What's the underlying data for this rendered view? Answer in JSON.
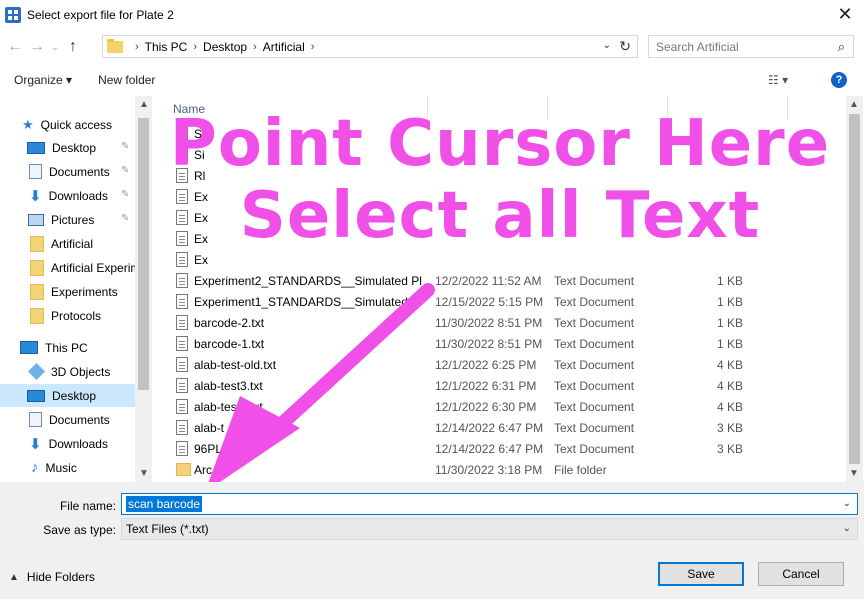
{
  "window": {
    "title": "Select export file for Plate 2",
    "close_glyph": "✕"
  },
  "nav": {
    "back": "←",
    "forward": "→",
    "recent": "⌄",
    "up": "↑"
  },
  "address": {
    "crumbs": [
      "This PC",
      "Desktop",
      "Artificial"
    ],
    "separator": "›",
    "dropdown": "⌄",
    "refresh": "↻"
  },
  "search": {
    "placeholder": "Search Artificial",
    "icon": "⌕"
  },
  "toolbar": {
    "organize_label": "Organize ▾",
    "new_folder_label": "New folder",
    "view_label": "☷ ▾",
    "help_label": "?"
  },
  "sidebar": {
    "items": [
      {
        "label": "Quick access",
        "icon": "star-icon"
      },
      {
        "label": "Desktop",
        "icon": "desktop-icon",
        "pinned": true
      },
      {
        "label": "Documents",
        "icon": "documents-icon",
        "pinned": true
      },
      {
        "label": "Downloads",
        "icon": "downloads-icon",
        "pinned": true
      },
      {
        "label": "Pictures",
        "icon": "pictures-icon",
        "pinned": true
      },
      {
        "label": "Artificial",
        "icon": "folder-icon"
      },
      {
        "label": "Artificial Experim",
        "icon": "folder-icon"
      },
      {
        "label": "Experiments",
        "icon": "folder-icon"
      },
      {
        "label": "Protocols",
        "icon": "folder-icon"
      },
      {
        "label": "This PC",
        "icon": "pc-icon"
      },
      {
        "label": "3D Objects",
        "icon": "3d-objects-icon"
      },
      {
        "label": "Desktop",
        "icon": "desktop-icon",
        "selected": true
      },
      {
        "label": "Documents",
        "icon": "documents-icon"
      },
      {
        "label": "Downloads",
        "icon": "downloads-icon"
      },
      {
        "label": "Music",
        "icon": "music-icon"
      }
    ],
    "pin_glyph": "📌"
  },
  "filelist": {
    "header_name": "Name",
    "rows": [
      {
        "name": "Si",
        "date": "",
        "type": "",
        "size": ""
      },
      {
        "name": "Si",
        "date": "",
        "type": "",
        "size": ""
      },
      {
        "name": "Rl",
        "date": "",
        "type": "",
        "size": ""
      },
      {
        "name": "Ex",
        "date": "",
        "type": "",
        "size": ""
      },
      {
        "name": "Ex",
        "date": "",
        "type": "",
        "size": ""
      },
      {
        "name": "Ex",
        "date": "",
        "type": "",
        "size": ""
      },
      {
        "name": "Ex",
        "date": "",
        "type": "",
        "size": ""
      },
      {
        "name": "Experiment2_STANDARDS__Simulated Pl...",
        "date": "12/2/2022 11:52 AM",
        "type": "Text Document",
        "size": "1 KB"
      },
      {
        "name": "Experiment1_STANDARDS__Simulated Pl...",
        "date": "12/15/2022 5:15 PM",
        "type": "Text Document",
        "size": "1 KB"
      },
      {
        "name": "barcode-2.txt",
        "date": "11/30/2022 8:51 PM",
        "type": "Text Document",
        "size": "1 KB"
      },
      {
        "name": "barcode-1.txt",
        "date": "11/30/2022 8:51 PM",
        "type": "Text Document",
        "size": "1 KB"
      },
      {
        "name": "alab-test-old.txt",
        "date": "12/1/2022 6:25 PM",
        "type": "Text Document",
        "size": "4 KB"
      },
      {
        "name": "alab-test3.txt",
        "date": "12/1/2022 6:31 PM",
        "type": "Text Document",
        "size": "4 KB"
      },
      {
        "name": "alab-test2.txt",
        "date": "12/1/2022 6:30 PM",
        "type": "Text Document",
        "size": "4 KB"
      },
      {
        "name": "alab-t",
        "date": "12/14/2022 6:47 PM",
        "type": "Text Document",
        "size": "3 KB"
      },
      {
        "name": "96PL",
        "date": "12/14/2022 6:47 PM",
        "type": "Text Document",
        "size": "3 KB"
      },
      {
        "name": "Arc",
        "date": "11/30/2022 3:18 PM",
        "type": "File folder",
        "size": "",
        "folder": true
      }
    ]
  },
  "annotation": {
    "line1": "Point Cursor Here",
    "line2": "Select all Text",
    "color": "#f04fe8"
  },
  "footer": {
    "file_name_label": "File name:",
    "file_name_value": "scan barcode",
    "save_type_label": "Save as type:",
    "save_type_value": "Text Files (*.txt)",
    "hide_folders_label": "Hide Folders",
    "save_label": "Save",
    "cancel_label": "Cancel"
  }
}
